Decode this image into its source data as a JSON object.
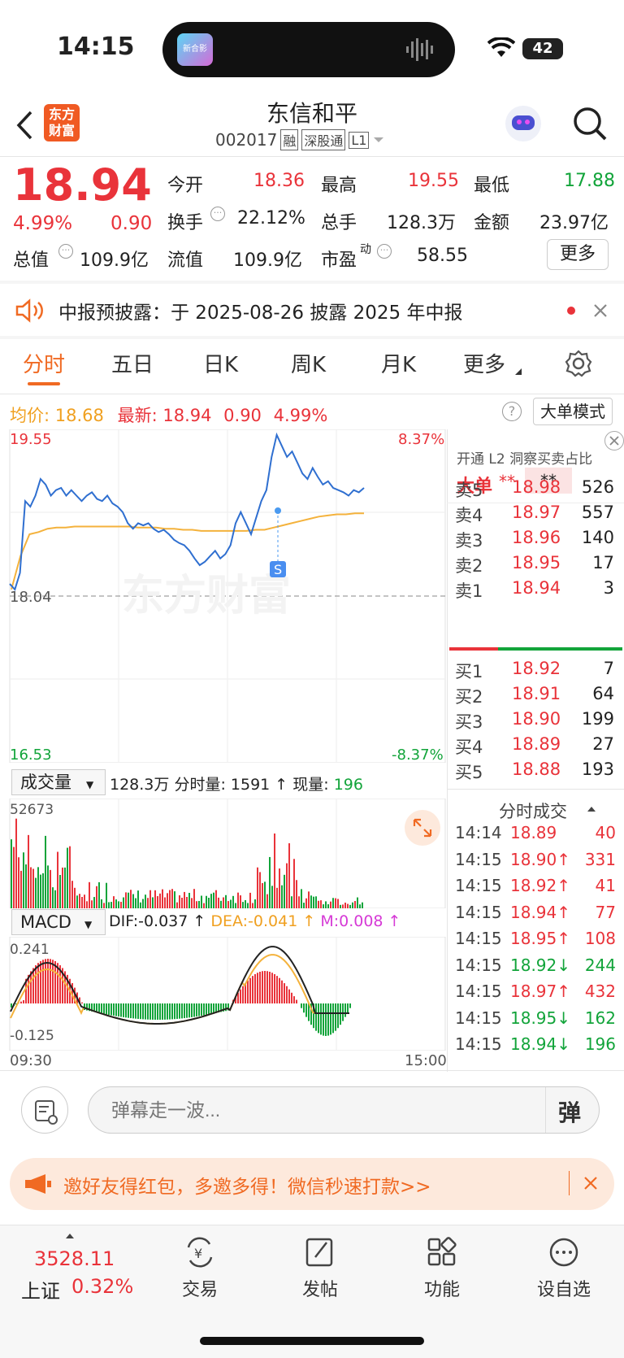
{
  "status": {
    "time": "14:15",
    "battery": "42",
    "island_badge": "新合影"
  },
  "header": {
    "title": "东信和平",
    "code": "002017",
    "badges": [
      "融",
      "深股通",
      "L1"
    ],
    "logo": "东方\n财富"
  },
  "quote": {
    "price": "18.94",
    "change_pct": "4.99%",
    "change": "0.90",
    "open_label": "今开",
    "open": "18.36",
    "high_label": "最高",
    "high": "19.55",
    "low_label": "最低",
    "low": "17.88",
    "turnover_label": "换手",
    "turnover": "22.12%",
    "volume_label": "总手",
    "volume": "128.3万",
    "amount_label": "金额",
    "amount": "23.97亿",
    "mcap_label": "总值",
    "mcap": "109.9亿",
    "float_label": "流值",
    "float": "109.9亿",
    "pe_label": "市盈",
    "pe_sup": "动",
    "pe": "58.55",
    "more": "更多"
  },
  "notice": {
    "text": "中报预披露：于 2025-08-26 披露 2025 年中报"
  },
  "tabs": [
    "分时",
    "五日",
    "日K",
    "周K",
    "月K",
    "更多"
  ],
  "chart_info": {
    "avg_label": "均价:",
    "avg": "18.68",
    "last_label": "最新:",
    "last": "18.94",
    "chg": "0.90",
    "pct": "4.99%",
    "mode": "大单模式"
  },
  "chart_data": {
    "type": "line",
    "title": "",
    "y_top": "19.55",
    "y_mid": "18.04",
    "y_bottom": "16.53",
    "pct_top": "8.37%",
    "pct_bottom": "-8.37%",
    "x_start": "09:30",
    "x_end": "15:00",
    "ylim": [
      16.53,
      19.55
    ],
    "price": [
      18.15,
      18.1,
      18.25,
      18.9,
      18.85,
      18.95,
      19.1,
      19.05,
      18.95,
      19.0,
      19.02,
      18.95,
      19.0,
      18.95,
      18.9,
      18.95,
      18.98,
      18.92,
      18.9,
      18.95,
      18.88,
      18.85,
      18.8,
      18.7,
      18.65,
      18.7,
      18.68,
      18.7,
      18.65,
      18.62,
      18.64,
      18.6,
      18.55,
      18.52,
      18.5,
      18.45,
      18.38,
      18.32,
      18.35,
      18.4,
      18.45,
      18.38,
      18.42,
      18.5,
      18.7,
      18.8,
      18.7,
      18.6,
      18.75,
      18.9,
      19.0,
      19.3,
      19.5,
      19.4,
      19.3,
      19.35,
      19.25,
      19.15,
      19.1,
      19.2,
      19.12,
      19.05,
      19.08,
      19.02,
      19.0,
      18.98,
      18.95,
      19.0,
      18.98,
      19.02
    ],
    "avg_line": [
      18.1,
      18.4,
      18.6,
      18.62,
      18.65,
      18.66,
      18.66,
      18.67,
      18.67,
      18.67,
      18.67,
      18.67,
      18.67,
      18.67,
      18.66,
      18.66,
      18.66,
      18.65,
      18.65,
      18.64,
      18.64,
      18.63,
      18.63,
      18.63,
      18.63,
      18.63,
      18.63,
      18.64,
      18.64,
      18.66,
      18.68,
      18.7,
      18.72,
      18.74,
      18.76,
      18.77,
      18.78,
      18.78,
      18.79,
      18.79
    ],
    "volume_max": "52673",
    "volume_label": "成交量",
    "volume_total": "128.3万",
    "min_vol_label": "分时量:",
    "min_vol": "1591",
    "cur_vol_label": "现量:",
    "cur_vol": "196",
    "macd": {
      "label": "MACD",
      "dif_label": "DIF:",
      "dif": "-0.037",
      "dea_label": "DEA:",
      "dea": "-0.041",
      "m_label": "M:",
      "m": "0.008",
      "top": "0.241",
      "bottom": "-0.125"
    }
  },
  "orderbook": {
    "promo": "开通 L2 洞察买卖占比",
    "big_label": "大单",
    "big_val": "**",
    "big_val2": "**",
    "asks": [
      {
        "l": "卖5",
        "p": "18.98",
        "v": "526"
      },
      {
        "l": "卖4",
        "p": "18.97",
        "v": "557"
      },
      {
        "l": "卖3",
        "p": "18.96",
        "v": "140"
      },
      {
        "l": "卖2",
        "p": "18.95",
        "v": "17"
      },
      {
        "l": "卖1",
        "p": "18.94",
        "v": "3"
      }
    ],
    "bids": [
      {
        "l": "买1",
        "p": "18.92",
        "v": "7"
      },
      {
        "l": "买2",
        "p": "18.91",
        "v": "64"
      },
      {
        "l": "买3",
        "p": "18.90",
        "v": "199"
      },
      {
        "l": "买4",
        "p": "18.89",
        "v": "27"
      },
      {
        "l": "买5",
        "p": "18.88",
        "v": "193"
      }
    ]
  },
  "trades": {
    "title": "分时成交",
    "rows": [
      {
        "t": "14:14",
        "p": "18.89",
        "v": "40",
        "c": "red"
      },
      {
        "t": "14:15",
        "p": "18.90↑",
        "v": "331",
        "c": "red"
      },
      {
        "t": "14:15",
        "p": "18.92↑",
        "v": "41",
        "c": "red"
      },
      {
        "t": "14:15",
        "p": "18.94↑",
        "v": "77",
        "c": "red"
      },
      {
        "t": "14:15",
        "p": "18.95↑",
        "v": "108",
        "c": "red"
      },
      {
        "t": "14:15",
        "p": "18.92↓",
        "v": "244",
        "c": "green"
      },
      {
        "t": "14:15",
        "p": "18.97↑",
        "v": "432",
        "c": "red"
      },
      {
        "t": "14:15",
        "p": "18.95↓",
        "v": "162",
        "c": "green"
      },
      {
        "t": "14:15",
        "p": "18.94↓",
        "v": "196",
        "c": "green"
      }
    ]
  },
  "comment": {
    "placeholder": "弹幕走一波...",
    "danmu": "弹"
  },
  "promo_bar": {
    "text": "邀好友得红包，多邀多得！微信秒速打款>>"
  },
  "bottom_nav": {
    "index_value": "3528.11",
    "index_name": "上证",
    "index_pct": "0.32%",
    "items": [
      "交易",
      "发帖",
      "功能",
      "设自选"
    ]
  }
}
